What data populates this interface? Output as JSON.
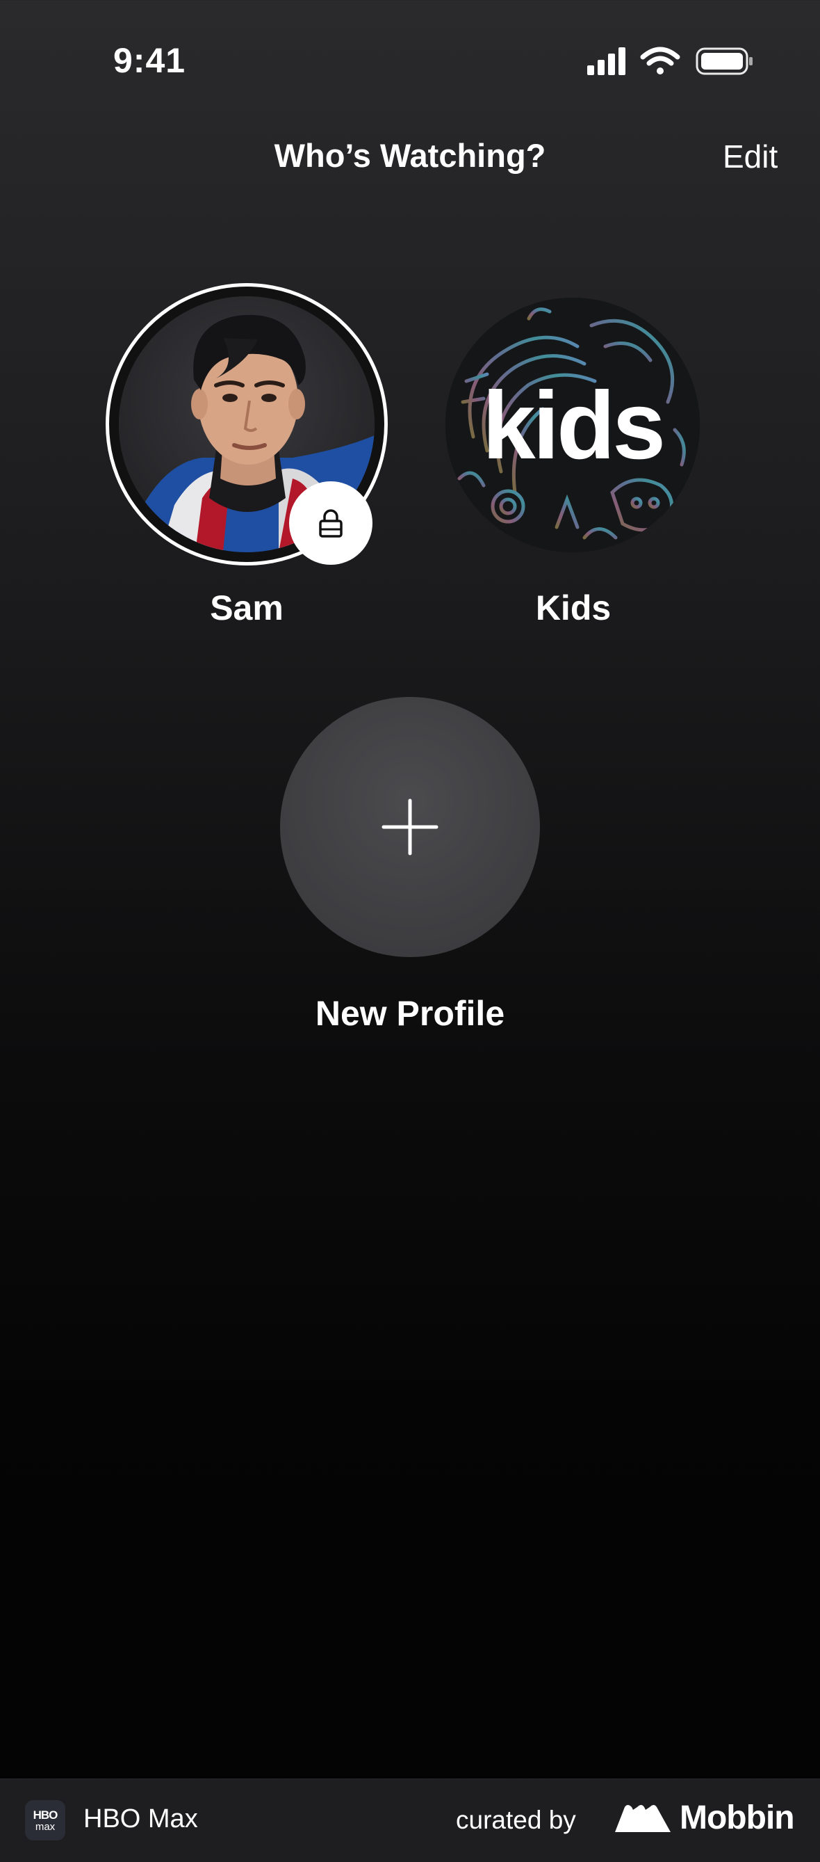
{
  "status_bar": {
    "time": "9:41"
  },
  "header": {
    "title": "Who’s Watching?",
    "edit_label": "Edit"
  },
  "profiles": [
    {
      "name": "Sam",
      "locked": true
    },
    {
      "name": "Kids",
      "avatar_text": "kids"
    }
  ],
  "new_profile": {
    "label": "New Profile"
  },
  "footer": {
    "app_icon_line1": "HBO",
    "app_icon_line2": "max",
    "app_name": "HBO Max",
    "curated_by": "curated by",
    "brand": "Mobbin"
  },
  "icons": {
    "signal": "cellular-signal-icon",
    "wifi": "wifi-icon",
    "battery": "battery-icon",
    "lock": "lock-icon",
    "plus": "plus-icon",
    "mobbin": "mobbin-logo-icon"
  },
  "colors": {
    "background_top": "#2a2a2c",
    "background_bottom": "#030303",
    "new_profile_circle": "#444447",
    "bottom_bar": "#1e1e20"
  }
}
